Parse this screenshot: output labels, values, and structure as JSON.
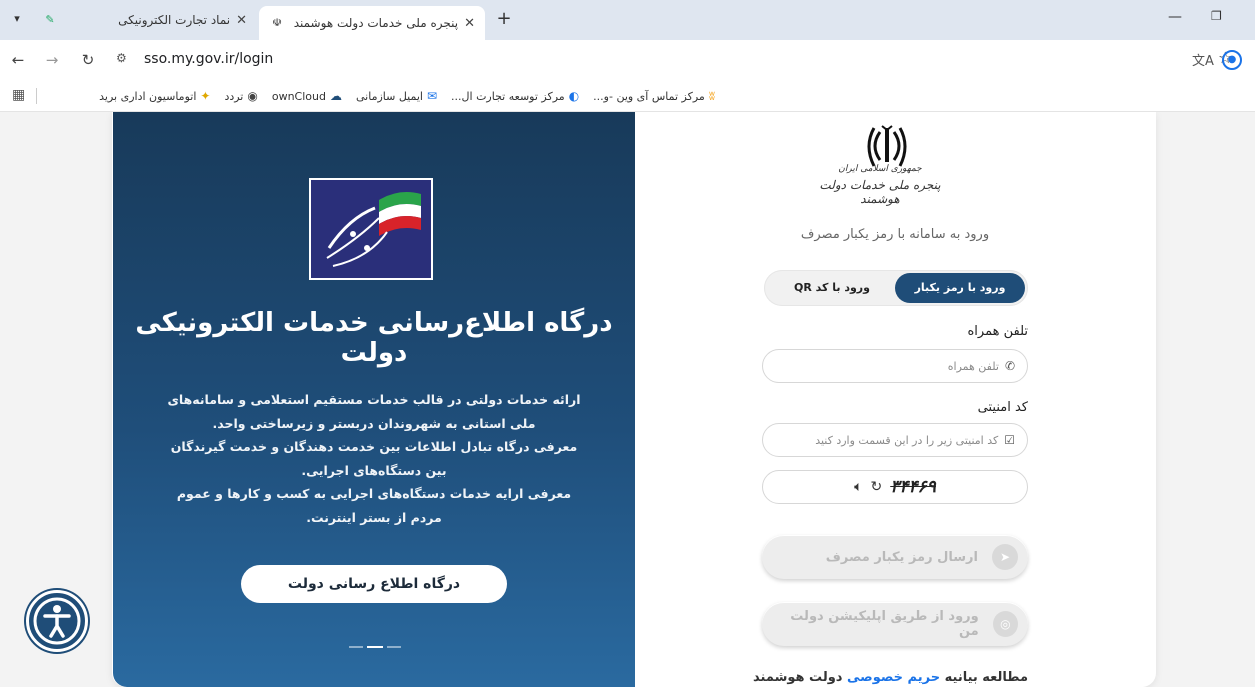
{
  "browser": {
    "tabs": [
      {
        "title": "نماد تجارت الکترونیکی",
        "active": false
      },
      {
        "title": "پنجره ملی خدمات دولت هوشمند",
        "active": true
      }
    ],
    "url": "sso.my.gov.ir/login",
    "bookmarks": [
      {
        "label": "مرکز تماس آی وین -و...",
        "icon": "bookmark-dots-icon"
      },
      {
        "label": "مرکز توسعه تجارت ال...",
        "icon": "globe-icon"
      },
      {
        "label": "ایمیل سازمانی",
        "icon": "mail-icon"
      },
      {
        "label": "ownCloud",
        "icon": "cloud-icon"
      },
      {
        "label": "تردد",
        "icon": "globe-icon"
      },
      {
        "label": "اتوماسیون اداری برید",
        "icon": "star-icon"
      }
    ]
  },
  "promo": {
    "title": "درگاه اطلاع‌رسانی خدمات الکترونیکی دولت",
    "description": [
      "ارائه خدمات دولتی در قالب خدمات مستقیم استعلامی و سامانه‌های",
      "ملی استانی به شهروندان دربستر و زیرساختی واحد.",
      "معرفی درگاه تبادل اطلاعات بین خدمت دهندگان و خدمت گیرندگان",
      "بین دستگاه‌های اجرایی.",
      "معرفی ارایه خدمات دستگاه‌های اجرایی به کسب و کارها و عموم",
      "مردم از بستر اینترنت."
    ],
    "button_label": "درگاه اطلاع رسانی دولت"
  },
  "login": {
    "logo_line1": "جمهوری اسلامی ایران",
    "logo_line2": "پنجره ملی خدمات دولت هوشمند",
    "subtitle": "ورود به سامانه با رمز یکبار مصرف",
    "tab_otp": "ورود با رمز یکبار مصرف",
    "tab_qr": "ورود با کد QR",
    "phone_label": "تلفن همراه",
    "phone_placeholder": "تلفن همراه",
    "captcha_label": "کد امنیتی",
    "captcha_placeholder": "کد امنیتی زیر را در این قسمت وارد کنید",
    "captcha_code": "۳۴۴۶۹",
    "send_button": "ارسال رمز یکبار مصرف",
    "app_button": "ورود از طریق اپلیکیشن دولت من",
    "footer_prefix": "مطالعه بیانیه",
    "footer_link": "حریم خصوصی",
    "footer_suffix": "دولت هوشمند"
  },
  "colors": {
    "brand": "#1f4d78",
    "promo_bg": "#1f4e7a",
    "disabled_text": "#b9b9b9"
  }
}
